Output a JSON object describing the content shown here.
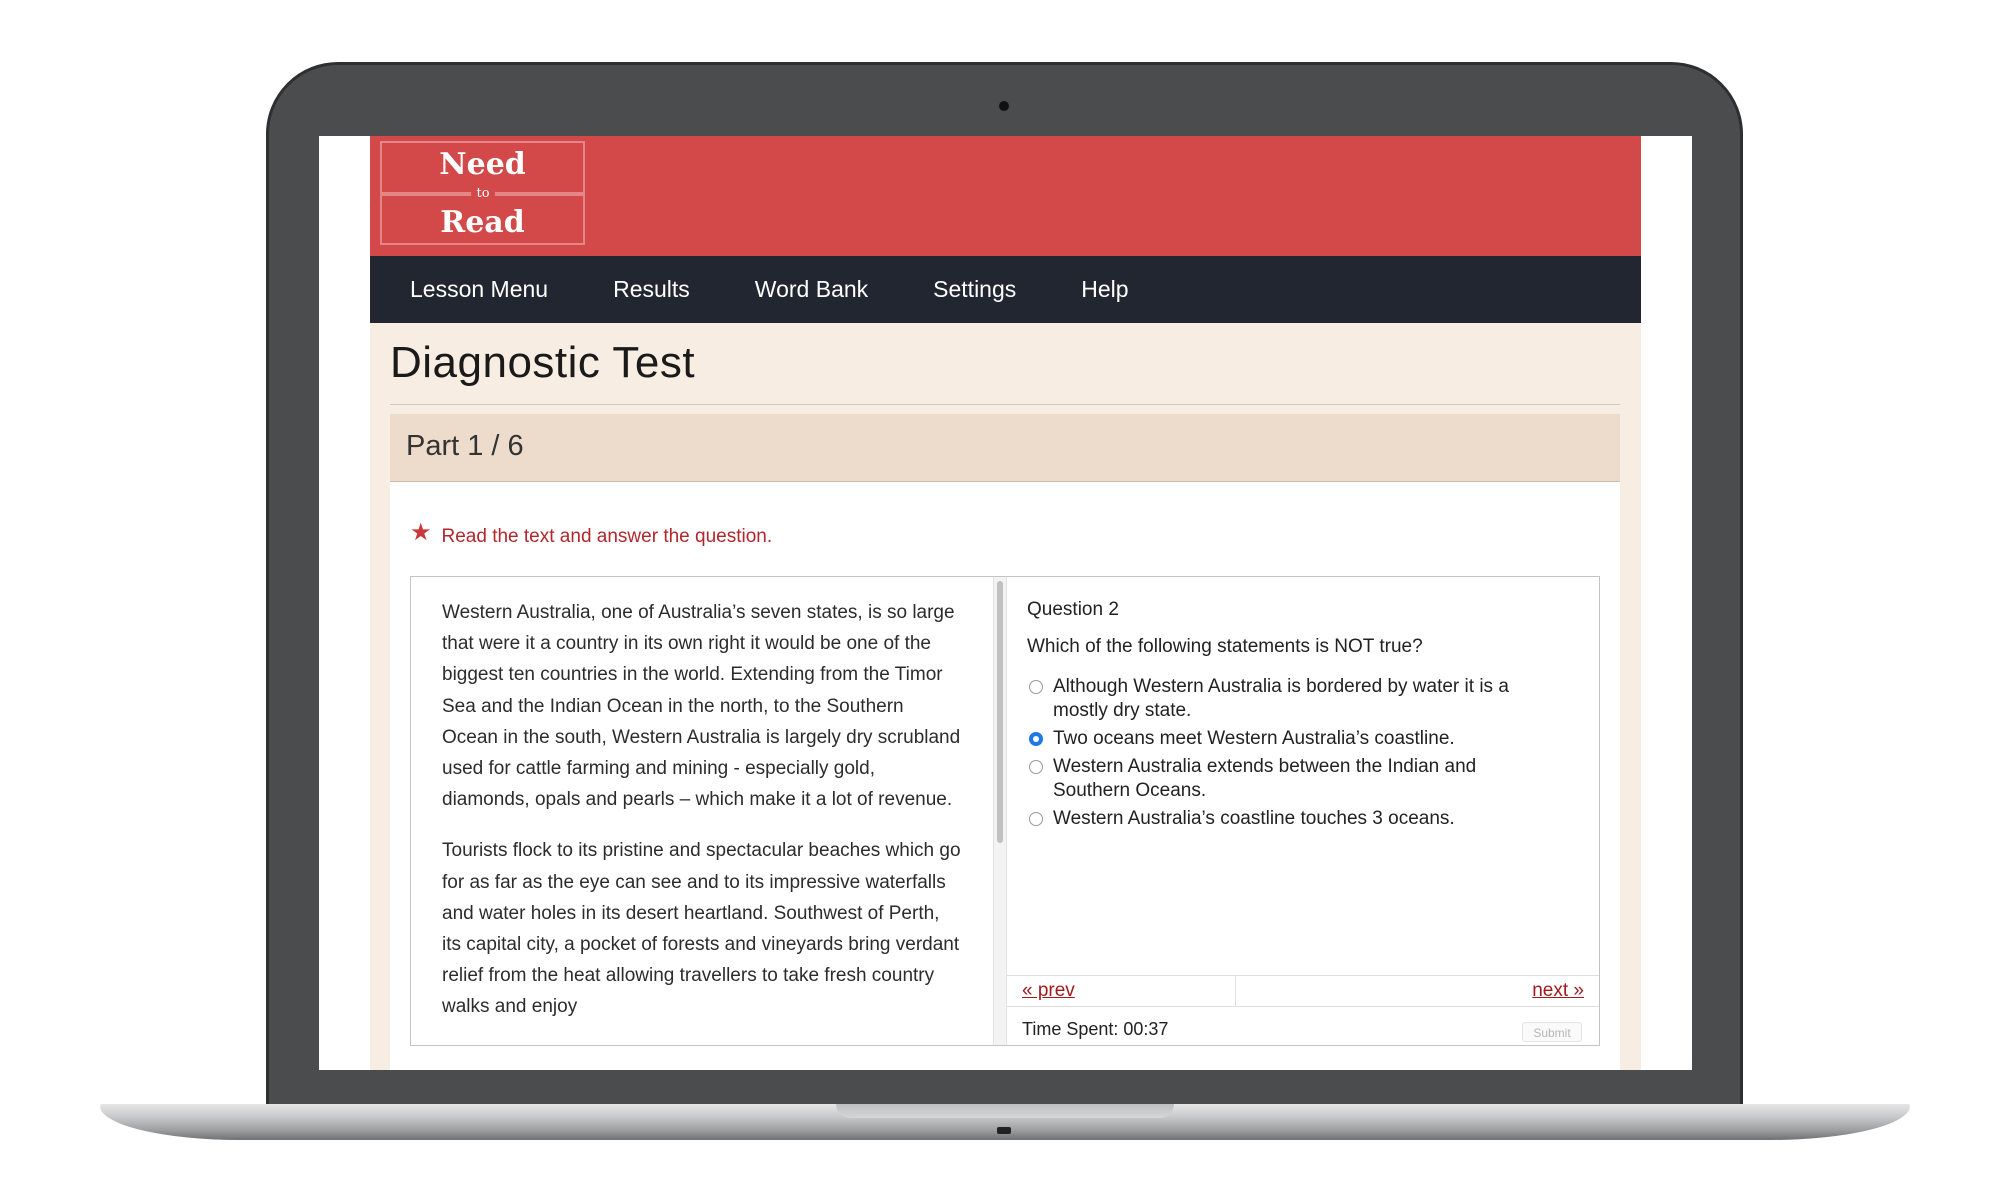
{
  "brand": {
    "logo_top": "Need",
    "logo_mid": "to",
    "logo_bottom": "Read",
    "color": "#d3494a"
  },
  "nav": {
    "items": [
      {
        "label": "Lesson Menu"
      },
      {
        "label": "Results"
      },
      {
        "label": "Word Bank"
      },
      {
        "label": "Settings"
      },
      {
        "label": "Help"
      }
    ]
  },
  "page": {
    "title": "Diagnostic Test",
    "part_label": "Part 1 / 6",
    "instruction": "Read the text and answer the question.",
    "instruction_icon": "star-icon"
  },
  "passage": {
    "paragraphs": [
      "Western Australia, one of Australia’s seven states, is so large that were it a country in its own right it would be one of the biggest ten countries in the world. Extending from the Timor Sea and the Indian Ocean in the north, to the Southern Ocean in the south, Western Australia is largely dry scrubland used for cattle farming and mining - especially gold, diamonds, opals and pearls – which make it a lot of revenue.",
      "Tourists flock to its pristine and spectacular beaches which go for as far as the eye can see and to its impressive waterfalls and water holes in its desert heartland. Southwest of Perth, its capital city, a pocket of forests and vineyards bring verdant relief from the heat allowing travellers to take fresh country walks and enjoy"
    ]
  },
  "question": {
    "number_label": "Question 2",
    "text": "Which of the following statements is NOT true?",
    "selected_index": 1,
    "options": [
      {
        "text": "Although Western Australia is bordered by water it is a mostly dry state."
      },
      {
        "text": "Two oceans meet Western Australia’s coastline."
      },
      {
        "text": "Western Australia extends between the Indian and Southern Oceans."
      },
      {
        "text": "Western Australia’s coastline touches 3 oceans."
      }
    ]
  },
  "footer": {
    "prev_label": "« prev",
    "next_label": "next »",
    "time_spent": "Time Spent: 00:37",
    "submit_label": "Submit"
  }
}
